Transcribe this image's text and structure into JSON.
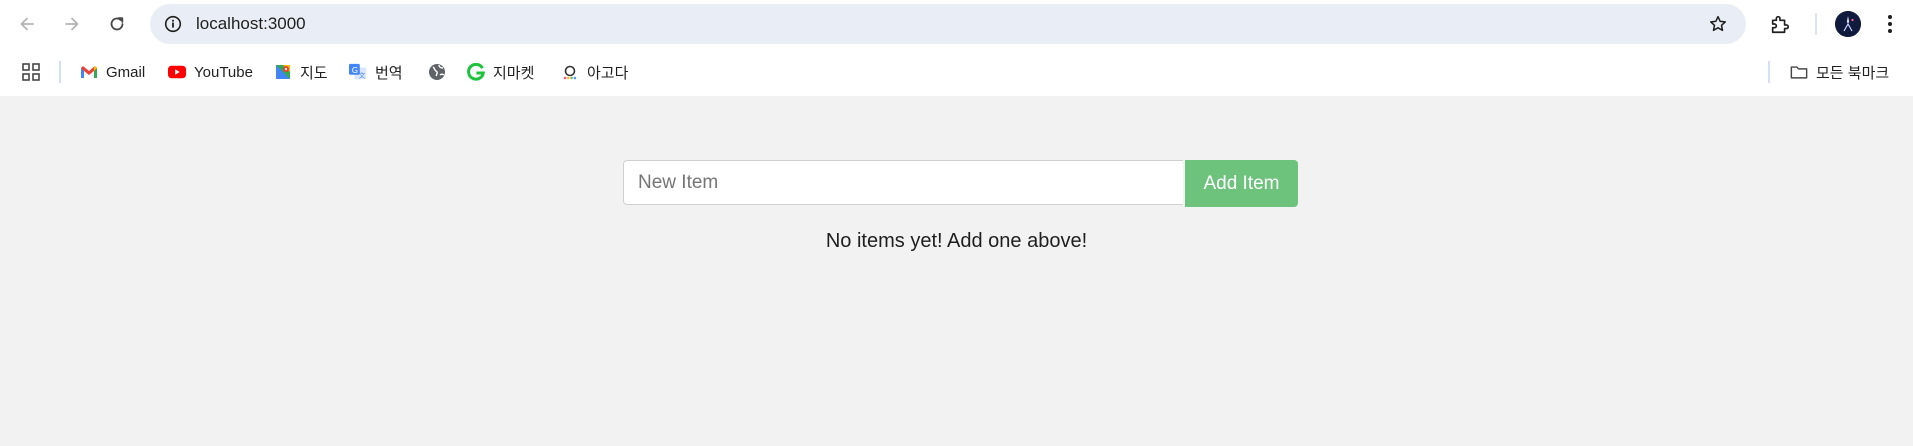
{
  "browser": {
    "url": "localhost:3000"
  },
  "bookmarks": {
    "items": [
      {
        "label": "Gmail",
        "icon": "gmail-icon"
      },
      {
        "label": "YouTube",
        "icon": "youtube-icon"
      },
      {
        "label": "지도",
        "icon": "maps-icon"
      },
      {
        "label": "번역",
        "icon": "translate-icon"
      },
      {
        "label": "",
        "icon": "globe-icon"
      },
      {
        "label": "지마켓",
        "icon": "gmarket-icon"
      },
      {
        "label": "아고다",
        "icon": "agoda-icon"
      }
    ],
    "all_bookmarks_label": "모든 북마크"
  },
  "app": {
    "input_placeholder": "New Item",
    "add_button_label": "Add Item",
    "empty_message": "No items yet! Add one above!",
    "colors": {
      "accent": "#6dc37c",
      "background": "#f2f2f2"
    }
  }
}
